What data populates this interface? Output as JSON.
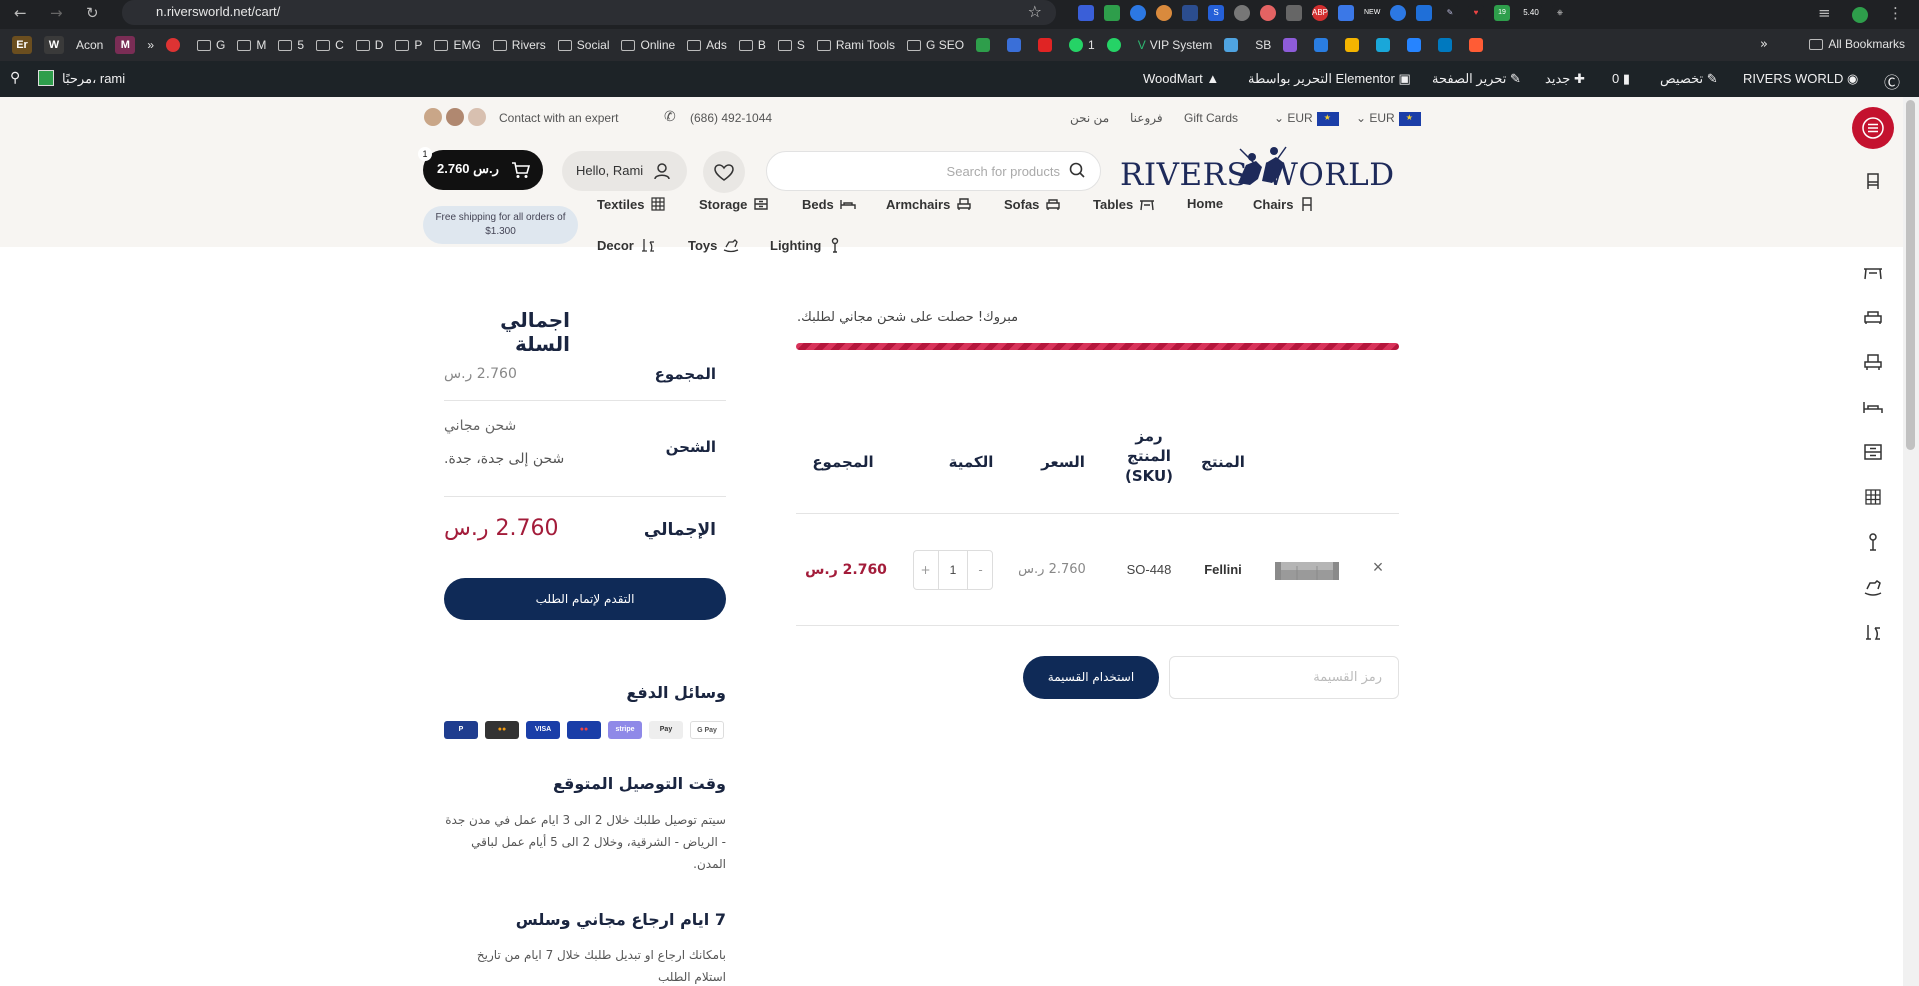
{
  "browser": {
    "url": "n.riversworld.net/cart/",
    "extensions": [
      "shield-ext",
      "green-ext",
      "wave-ext",
      "colorful-ext",
      "blue-ext",
      "s-ext",
      "gray-ext",
      "red-ext",
      "box-ext",
      "ABP",
      "translate-ext",
      "NEW",
      "chrome-ext",
      "download-ext",
      "pen-ext",
      "heart-ext",
      "19",
      "5.40",
      "puzzle-ext"
    ],
    "extension_badges": {
      "abp": "ABP",
      "new": "NEW",
      "count": "19",
      "num": "5.40"
    }
  },
  "bookmarks": [
    {
      "label": "Er",
      "type": "badge",
      "color": "#6b4e1f"
    },
    {
      "label": "W",
      "type": "badge",
      "color": "#3a3a3a"
    },
    {
      "label": "Acon",
      "type": "text"
    },
    {
      "label": "M",
      "type": "badge",
      "color": "#7a2d55"
    },
    {
      "label": "»",
      "type": "text"
    },
    {
      "label": "",
      "type": "dot"
    },
    {
      "label": "G",
      "type": "folder"
    },
    {
      "label": "M",
      "type": "folder"
    },
    {
      "label": "5",
      "type": "folder"
    },
    {
      "label": "C",
      "type": "folder"
    },
    {
      "label": "D",
      "type": "folder"
    },
    {
      "label": "P",
      "type": "folder"
    },
    {
      "label": "EMG",
      "type": "folder"
    },
    {
      "label": "Rivers",
      "type": "folder"
    },
    {
      "label": "Social",
      "type": "folder"
    },
    {
      "label": "Online",
      "type": "folder"
    },
    {
      "label": "Ads",
      "type": "folder"
    },
    {
      "label": "B",
      "type": "folder"
    },
    {
      "label": "S",
      "type": "folder"
    },
    {
      "label": "Rami Tools",
      "type": "folder"
    },
    {
      "label": "G SEO",
      "type": "folder"
    },
    {
      "label": "",
      "type": "sq",
      "color": "#2e9e4b"
    },
    {
      "label": "",
      "type": "sq",
      "color": "#3a6fd8"
    },
    {
      "label": "",
      "type": "sq",
      "color": "#e02424"
    },
    {
      "label": "1",
      "type": "wa"
    },
    {
      "label": "",
      "type": "sq",
      "color": "#25d366"
    },
    {
      "label": "VIP System",
      "type": "vip"
    },
    {
      "label": "",
      "type": "sq",
      "color": "#4fa3e0"
    },
    {
      "label": "SB",
      "type": "text"
    },
    {
      "label": "",
      "type": "sq",
      "color": "#8e5cd9"
    },
    {
      "label": "",
      "type": "sq",
      "color": "#2a7de1"
    },
    {
      "label": "",
      "type": "sq",
      "color": "#f4b400"
    },
    {
      "label": "",
      "type": "sq",
      "color": "#1aa7d9"
    },
    {
      "label": "",
      "type": "sq",
      "color": "#2684ff"
    },
    {
      "label": "",
      "type": "sq",
      "color": "#0079bf"
    },
    {
      "label": "",
      "type": "sq",
      "color": "#ff5c35"
    }
  ],
  "bookmarks_overflow": "»",
  "all_bookmarks": "All Bookmarks",
  "wpbar": {
    "greeting": "مرحبًا، rami",
    "site_name": "RIVERS WORLD",
    "customize": "تخصيص",
    "comments_count": "0",
    "new": "جديد",
    "edit_page": "تحرير الصفحة",
    "elementor": "التحرير بواسطة Elementor",
    "woodmart": "WoodMart"
  },
  "topbar": {
    "contact": "Contact with an expert",
    "phone": "(686) 492-1044",
    "about": "من نحن",
    "branches": "فروعنا",
    "gift_cards": "Gift Cards",
    "currency1": "EUR",
    "currency2": "EUR"
  },
  "header": {
    "logo_left": "RIVERS",
    "logo_right": "WORLD",
    "search_placeholder": "Search for products",
    "account": "Hello, Rami",
    "cart_amount": "2.760 ر.س",
    "cart_count": "1",
    "free_shipping": "Free shipping for all orders of $1.300",
    "nav": [
      "Chairs",
      "Home",
      "Tables",
      "Sofas",
      "Armchairs",
      "Beds",
      "Storage",
      "Textiles",
      "Lighting",
      "Toys",
      "Decor"
    ]
  },
  "notice": "مبروك! حصلت على شحن مجاني لطلبك.",
  "free_shipping_progress": 1.0,
  "table": {
    "headers": {
      "product": "المنتج",
      "sku": "رمز المنتج (SKU)",
      "price": "السعر",
      "quantity": "الكمية",
      "total": "المجموع"
    },
    "rows": [
      {
        "name": "Fellini",
        "sku": "SO-448",
        "price": "2.760 ر.س",
        "quantity": "1",
        "total": "2.760 ر.س"
      }
    ],
    "remove": "×",
    "qty_minus": "-",
    "qty_plus": "+"
  },
  "coupon": {
    "placeholder": "رمز القسيمة",
    "button": "استخدام القسيمة"
  },
  "summary": {
    "title": "اجمالي السلة",
    "subtotal_label": "المجموع",
    "subtotal_value": "2.760 ر.س",
    "shipping_label": "الشحن",
    "shipping_value": "شحن مجاني",
    "shipping_dest": "شحن إلى جدة، جدة.",
    "total_label": "الإجمالي",
    "total_value": "2.760 ر.س",
    "checkout": "التقدم لإتمام الطلب"
  },
  "payment": {
    "title": "وسائل الدفع",
    "methods": [
      "PayPal",
      "Mastercard",
      "VISA",
      "Maestro",
      "Stripe",
      "Apple Pay",
      "G Pay"
    ]
  },
  "delivery": {
    "title": "وقت التوصيل المتوقع",
    "text": "سيتم توصيل طلبك خلال 2 الى 3 ايام عمل في مدن جدة - الرياض - الشرقية، وخلال 2 الى 5 أيام عمل لباقي المدن."
  },
  "returns": {
    "title": "7 ايام ارجاع مجاني وسلس",
    "text": "بامكانك ارجاع او تبديل طلبك خلال 7 ايام من تاريخ استلام الطلب"
  },
  "colors": {
    "navy": "#0f2a57",
    "accent_red": "#a31c3a",
    "menu_red": "#c4122f"
  }
}
